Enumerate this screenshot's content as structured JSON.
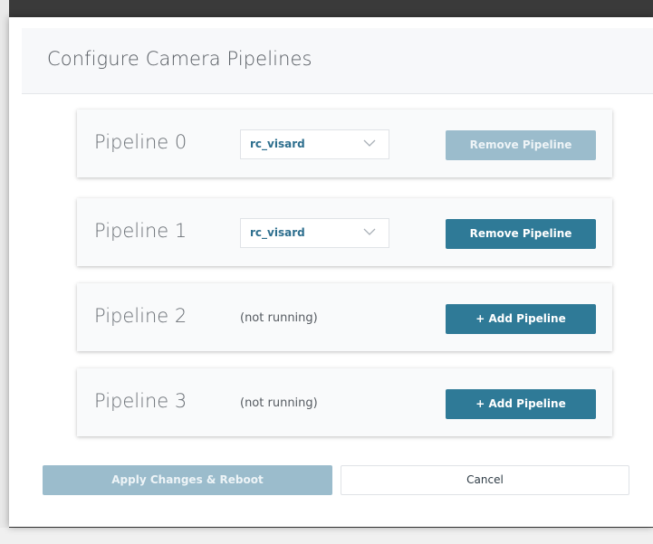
{
  "dialog": {
    "title": "Configure Camera Pipelines"
  },
  "pipelines": [
    {
      "name": "Pipeline 0",
      "device": "rc_visard",
      "status": "",
      "button_label": "Remove Pipeline",
      "button_state": "disabled"
    },
    {
      "name": "Pipeline 1",
      "device": "rc_visard",
      "status": "",
      "button_label": "Remove Pipeline",
      "button_state": "enabled"
    },
    {
      "name": "Pipeline 2",
      "device": "",
      "status": "(not running)",
      "button_label": "+ Add Pipeline",
      "button_state": "enabled"
    },
    {
      "name": "Pipeline 3",
      "device": "",
      "status": "(not running)",
      "button_label": "+ Add Pipeline",
      "button_state": "enabled"
    }
  ],
  "footer": {
    "apply_label": "Apply Changes & Reboot",
    "cancel_label": "Cancel"
  },
  "colors": {
    "primary": "#2f7a97",
    "primary_disabled": "#9bbccc",
    "select_text": "#2e6f8e"
  },
  "icons": {
    "select_chevron": "chevron-down-icon"
  }
}
